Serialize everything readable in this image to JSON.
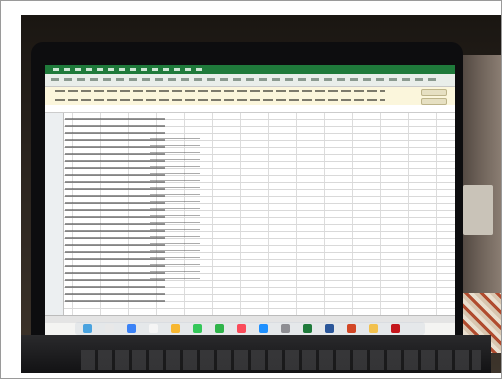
{
  "photo": {
    "description_alt": "",
    "screen": {
      "app": "spreadsheet",
      "dock_icons": [
        "finder",
        "safari",
        "mail",
        "calendar",
        "photos",
        "messages",
        "facetime",
        "music",
        "app-store",
        "settings",
        "excel",
        "word",
        "powerpoint",
        "chrome",
        "acrobat"
      ]
    }
  }
}
